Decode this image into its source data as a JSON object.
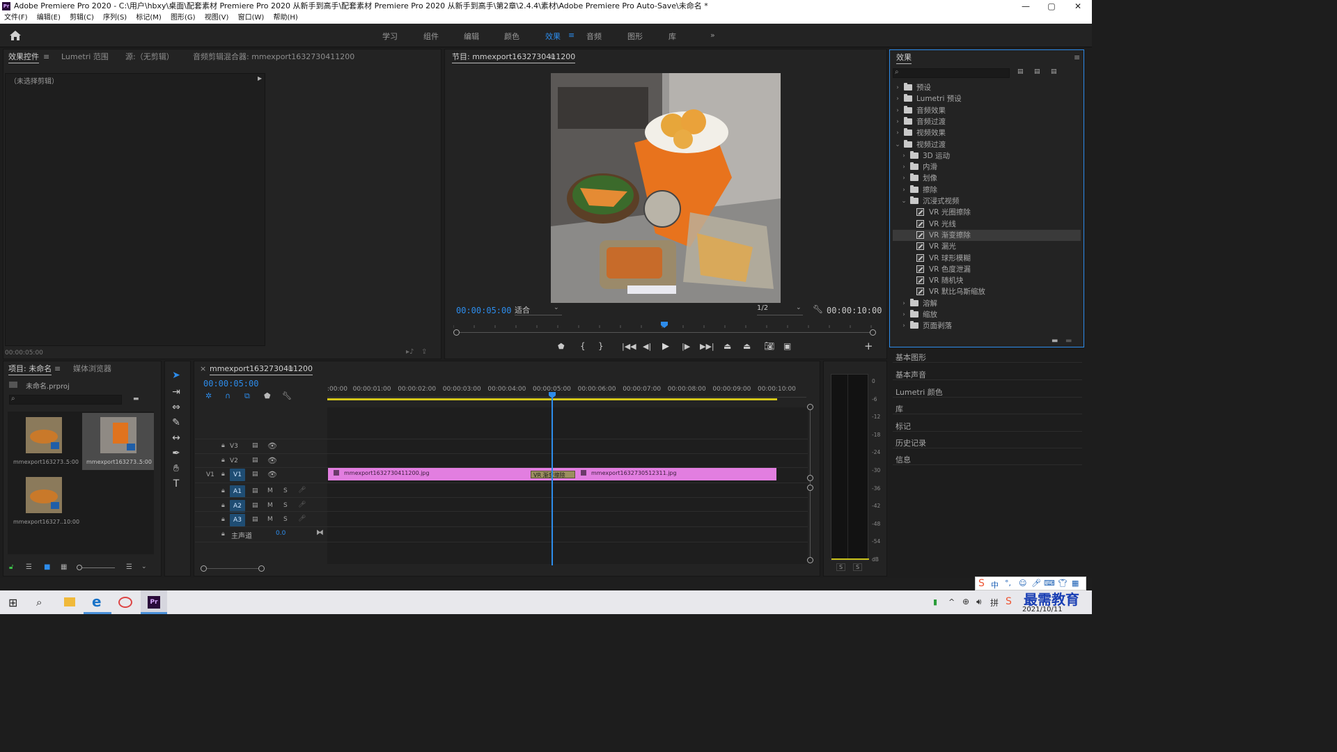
{
  "window": {
    "title": "Adobe Premiere Pro 2020 - C:\\用户\\hbxy\\桌面\\配套素材 Premiere Pro 2020 从新手到高手\\配套素材 Premiere Pro 2020 从新手到高手\\第2章\\2.4.4\\素材\\Adobe Premiere Pro Auto-Save\\未命名 *",
    "app_icon": "Pr",
    "controls": [
      "—",
      "▢",
      "✕"
    ]
  },
  "menu": [
    "文件(F)",
    "编辑(E)",
    "剪辑(C)",
    "序列(S)",
    "标记(M)",
    "图形(G)",
    "视图(V)",
    "窗口(W)",
    "帮助(H)"
  ],
  "workspaces": {
    "items": [
      "学习",
      "组件",
      "编辑",
      "颜色",
      "效果",
      "音频",
      "图形",
      "库"
    ],
    "active": "效果",
    "more": "»"
  },
  "source_panel": {
    "tabs": [
      "效果控件",
      "Lumetri 范围",
      "源:（无剪辑）",
      "音频剪辑混合器: mmexport1632730411200"
    ],
    "no_clip": "（未选择剪辑）",
    "timecode": "00:00:05:00"
  },
  "program": {
    "title": "节目: mmexport1632730411200",
    "timecode": "00:00:05:00",
    "fit": "适合",
    "resolution": "1/2",
    "duration": "00:00:10:00"
  },
  "project": {
    "tabs": [
      "项目: 未命名",
      "媒体浏览器"
    ],
    "file": "未命名.prproj",
    "items": [
      {
        "name": "mmexport163273...",
        "duration": "5:00"
      },
      {
        "name": "mmexport163273...",
        "duration": "5:00"
      },
      {
        "name": "mmexport16327...",
        "duration": "10:00"
      }
    ]
  },
  "timeline": {
    "sequence_name": "mmexport1632730411200",
    "timecode": "00:00:05:00",
    "ruler": [
      ":00:00",
      "00:00:01:00",
      "00:00:02:00",
      "00:00:03:00",
      "00:00:04:00",
      "00:00:05:00",
      "00:00:06:00",
      "00:00:07:00",
      "00:00:08:00",
      "00:00:09:00",
      "00:00:10:00"
    ],
    "video_tracks": [
      "V3",
      "V2",
      "V1"
    ],
    "audio_tracks": [
      "A1",
      "A2",
      "A3"
    ],
    "master": "主声道",
    "master_value": "0.0",
    "clip1": "mmexport1632730411200.jpg",
    "clip2": "mmexport1632730512311.jpg",
    "transition": "VR 渐变擦除",
    "source_patch": "V1"
  },
  "meter": {
    "labels": [
      "0",
      "-6",
      "-12",
      "-18",
      "-24",
      "-30",
      "-36",
      "-42",
      "-48",
      "-54",
      "dB"
    ],
    "solo": [
      "S",
      "S"
    ]
  },
  "effects": {
    "title": "效果",
    "tree": [
      {
        "label": "预设",
        "type": "folder",
        "depth": 0,
        "open": false
      },
      {
        "label": "Lumetri 预设",
        "type": "folder",
        "depth": 0,
        "open": false
      },
      {
        "label": "音频效果",
        "type": "folder",
        "depth": 0,
        "open": false
      },
      {
        "label": "音频过渡",
        "type": "folder",
        "depth": 0,
        "open": false
      },
      {
        "label": "视频效果",
        "type": "folder",
        "depth": 0,
        "open": false
      },
      {
        "label": "视频过渡",
        "type": "folder",
        "depth": 0,
        "open": true
      },
      {
        "label": "3D 运动",
        "type": "folder",
        "depth": 1,
        "open": false
      },
      {
        "label": "内滑",
        "type": "folder",
        "depth": 1,
        "open": false
      },
      {
        "label": "划像",
        "type": "folder",
        "depth": 1,
        "open": false
      },
      {
        "label": "擦除",
        "type": "folder",
        "depth": 1,
        "open": false
      },
      {
        "label": "沉浸式视频",
        "type": "folder",
        "depth": 1,
        "open": true
      },
      {
        "label": "VR 光圈擦除",
        "type": "fx",
        "depth": 2
      },
      {
        "label": "VR 光线",
        "type": "fx",
        "depth": 2
      },
      {
        "label": "VR 渐变擦除",
        "type": "fx",
        "depth": 2,
        "selected": true
      },
      {
        "label": "VR 漏光",
        "type": "fx",
        "depth": 2
      },
      {
        "label": "VR 球形模糊",
        "type": "fx",
        "depth": 2
      },
      {
        "label": "VR 色度泄漏",
        "type": "fx",
        "depth": 2
      },
      {
        "label": "VR 随机块",
        "type": "fx",
        "depth": 2
      },
      {
        "label": "VR 默比乌斯缩放",
        "type": "fx",
        "depth": 2
      },
      {
        "label": "溶解",
        "type": "folder",
        "depth": 1,
        "open": false
      },
      {
        "label": "缩放",
        "type": "folder",
        "depth": 1,
        "open": false
      },
      {
        "label": "页面剥落",
        "type": "folder",
        "depth": 1,
        "open": false
      }
    ],
    "side_panels": [
      "基本图形",
      "基本声音",
      "Lumetri 颜色",
      "库",
      "标记",
      "历史记录",
      "信息"
    ]
  },
  "taskbar": {
    "date": "2021/10/11",
    "ime": "中",
    "watermark": "最需教育"
  },
  "colors": {
    "accent": "#2d8ceb",
    "clip": "#e27ee0",
    "work_area": "#d4c61a",
    "panel": "#232323"
  }
}
